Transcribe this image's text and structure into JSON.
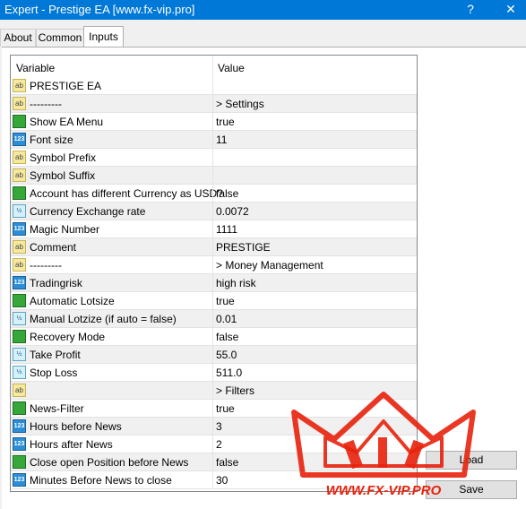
{
  "window": {
    "title": "Expert - Prestige EA [www.fx-vip.pro]",
    "help": "?",
    "close": "✕"
  },
  "tabs": [
    {
      "label": "About"
    },
    {
      "label": "Common"
    },
    {
      "label": "Inputs"
    }
  ],
  "table": {
    "headers": {
      "variable": "Variable",
      "value": "Value"
    },
    "rows": [
      {
        "icon": "ab",
        "name": "PRESTIGE EA",
        "value": ""
      },
      {
        "icon": "ab",
        "name": "---------",
        "value": "> Settings"
      },
      {
        "icon": "bool",
        "name": "Show EA Menu",
        "value": "true"
      },
      {
        "icon": "123",
        "name": "Font size",
        "value": "11"
      },
      {
        "icon": "ab",
        "name": "Symbol Prefix",
        "value": ""
      },
      {
        "icon": "ab",
        "name": "Symbol Suffix",
        "value": ""
      },
      {
        "icon": "bool",
        "name": "Account has different Currency as USD?",
        "value": "false"
      },
      {
        "icon": "frac",
        "name": "Currency Exchange rate",
        "value": "0.0072"
      },
      {
        "icon": "123",
        "name": "Magic Number",
        "value": "1111"
      },
      {
        "icon": "ab",
        "name": "Comment",
        "value": "PRESTIGE"
      },
      {
        "icon": "ab",
        "name": "---------",
        "value": "> Money Management"
      },
      {
        "icon": "123",
        "name": "Tradingrisk",
        "value": "high risk"
      },
      {
        "icon": "bool",
        "name": "Automatic Lotsize",
        "value": "true"
      },
      {
        "icon": "frac",
        "name": "Manual Lotzize (if auto = false)",
        "value": "0.01"
      },
      {
        "icon": "bool",
        "name": "Recovery Mode",
        "value": "false"
      },
      {
        "icon": "frac",
        "name": "Take Profit",
        "value": "55.0"
      },
      {
        "icon": "frac",
        "name": "Stop Loss",
        "value": "511.0"
      },
      {
        "icon": "ab",
        "name": "",
        "value": "> Filters"
      },
      {
        "icon": "bool",
        "name": "News-Filter",
        "value": "true"
      },
      {
        "icon": "123",
        "name": "Hours before News",
        "value": "3"
      },
      {
        "icon": "123",
        "name": "Hours after News",
        "value": "2"
      },
      {
        "icon": "bool",
        "name": "Close open Position before News",
        "value": "false"
      },
      {
        "icon": "123",
        "name": "Minutes Before News to close",
        "value": "30"
      }
    ]
  },
  "buttons": {
    "load": "Load",
    "save": "Save"
  },
  "watermark": {
    "text": "WWW.FX-VIP.PRO",
    "color": "#e8220c"
  }
}
